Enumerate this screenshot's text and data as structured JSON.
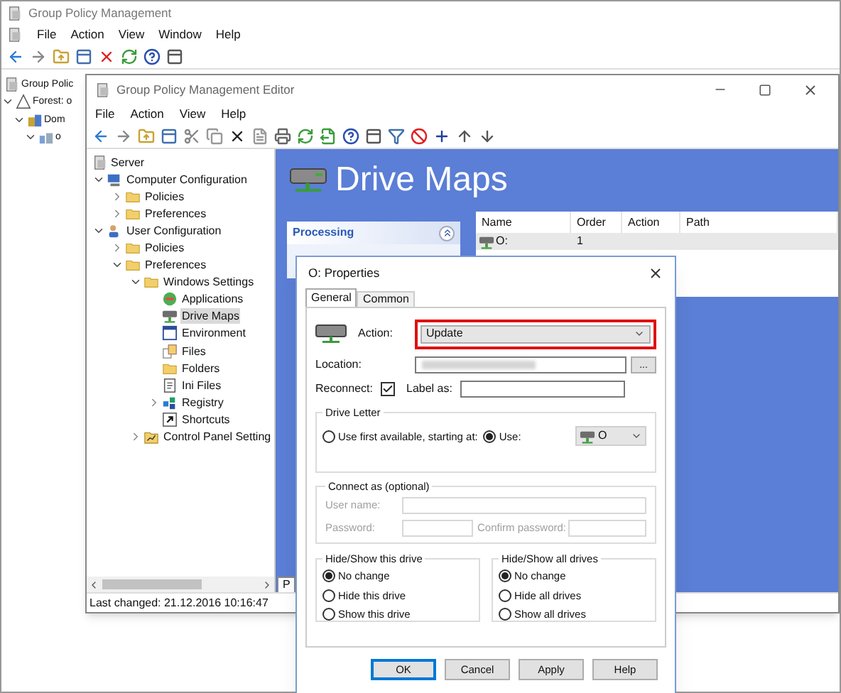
{
  "background_window": {
    "title": "Group Policy Management",
    "menu": [
      "File",
      "Action",
      "View",
      "Window",
      "Help"
    ],
    "tree": [
      {
        "label": "Group Polic",
        "kind": "root"
      },
      {
        "label": "Forest: o",
        "kind": "forest",
        "expanded": true
      },
      {
        "label": "Dom",
        "kind": "domain",
        "expanded": true
      },
      {
        "label": "o",
        "kind": "site",
        "expanded": true
      }
    ]
  },
  "editor": {
    "title": "Group Policy Management Editor",
    "menu": [
      "File",
      "Action",
      "View",
      "Help"
    ],
    "tree": {
      "root": "Server",
      "items": [
        {
          "label": "Computer Configuration",
          "kind": "computer",
          "expanded": true,
          "selected": false,
          "children": [
            {
              "label": "Policies",
              "kind": "folder",
              "expanded": false,
              "selected": false
            },
            {
              "label": "Preferences",
              "kind": "folder",
              "expanded": false,
              "selected": false
            }
          ]
        },
        {
          "label": "User Configuration",
          "kind": "user",
          "expanded": true,
          "selected": false,
          "children": [
            {
              "label": "Policies",
              "kind": "folder",
              "expanded": false,
              "selected": false
            },
            {
              "label": "Preferences",
              "kind": "folder",
              "expanded": true,
              "selected": false,
              "children": [
                {
                  "label": "Windows Settings",
                  "kind": "folder",
                  "expanded": true,
                  "selected": false,
                  "children": [
                    {
                      "label": "Applications",
                      "kind": "app",
                      "selected": false
                    },
                    {
                      "label": "Drive Maps",
                      "kind": "drive",
                      "selected": true
                    },
                    {
                      "label": "Environment",
                      "kind": "env",
                      "selected": false
                    },
                    {
                      "label": "Files",
                      "kind": "files",
                      "selected": false
                    },
                    {
                      "label": "Folders",
                      "kind": "folder",
                      "selected": false
                    },
                    {
                      "label": "Ini Files",
                      "kind": "ini",
                      "selected": false
                    },
                    {
                      "label": "Registry",
                      "kind": "registry",
                      "expanded": false,
                      "selected": false
                    },
                    {
                      "label": "Shortcuts",
                      "kind": "shortcut",
                      "selected": false
                    }
                  ]
                },
                {
                  "label": "Control Panel Setting",
                  "kind": "control",
                  "expanded": false,
                  "selected": false
                }
              ]
            }
          ]
        }
      ]
    },
    "heading": "Drive Maps",
    "processing_panel": {
      "title": "Processing",
      "expanded": true
    },
    "list": {
      "columns": [
        "Name",
        "Order",
        "Action",
        "Path"
      ],
      "rows": [
        {
          "name": "O:",
          "order": "1",
          "selected": true
        }
      ]
    },
    "bottom_tab": "P",
    "status_bar": "Last changed: 21.12.2016 10:16:47"
  },
  "dialog": {
    "title": "O: Properties",
    "tabs": [
      {
        "label": "General",
        "selected": true
      },
      {
        "label": "Common",
        "selected": false
      }
    ],
    "action": {
      "label": "Action:",
      "value": "Update",
      "highlighted": true
    },
    "location": {
      "label": "Location:",
      "browse": "..."
    },
    "reconnect": {
      "label": "Reconnect:",
      "checked": true
    },
    "label_as": {
      "label": "Label as:"
    },
    "drive_letter": {
      "title": "Drive Letter",
      "options": [
        {
          "label": "Use first available, starting at:",
          "selected": false
        },
        {
          "label": "Use:",
          "selected": true
        }
      ],
      "drive": "O"
    },
    "connect_as": {
      "title": "Connect as (optional)",
      "disabled": true,
      "user_name": "User name:",
      "password": "Password:",
      "confirm_password": "Confirm password:"
    },
    "hide_show_this": {
      "title": "Hide/Show this drive",
      "options": [
        {
          "label": "No change",
          "selected": true
        },
        {
          "label": "Hide this drive",
          "selected": false
        },
        {
          "label": "Show this drive",
          "selected": false
        }
      ]
    },
    "hide_show_all": {
      "title": "Hide/Show all drives",
      "options": [
        {
          "label": "No change",
          "selected": true
        },
        {
          "label": "Hide all drives",
          "selected": false
        },
        {
          "label": "Show all drives",
          "selected": false
        }
      ]
    },
    "buttons": [
      {
        "label": "OK",
        "default": true
      },
      {
        "label": "Cancel",
        "default": false
      },
      {
        "label": "Apply",
        "default": false
      },
      {
        "label": "Help",
        "default": false
      }
    ]
  }
}
